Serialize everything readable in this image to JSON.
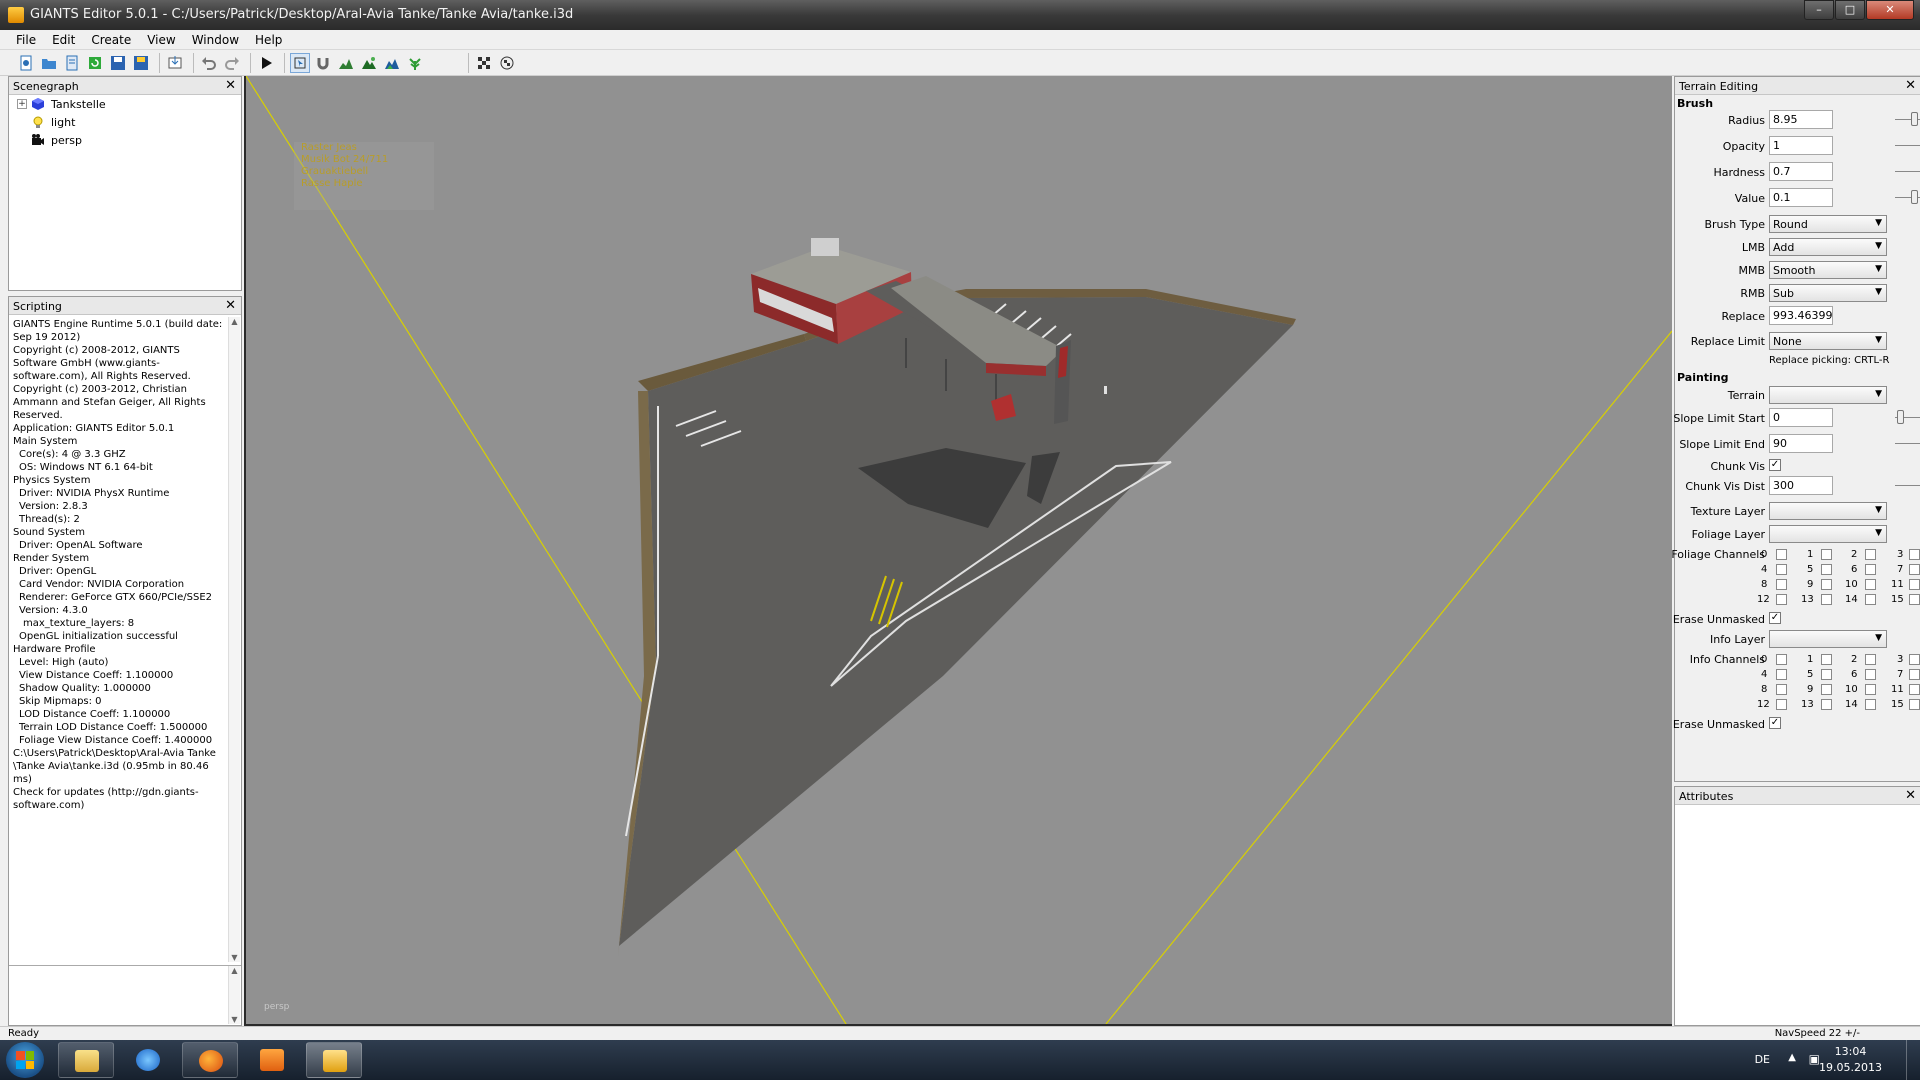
{
  "window": {
    "title": "GIANTS Editor 5.0.1 - C:/Users/Patrick/Desktop/Aral-Avia Tanke/Tanke Avia/tanke.i3d",
    "minimize": "–",
    "maximize": "□",
    "close": "✕"
  },
  "menu": [
    {
      "label": "File"
    },
    {
      "label": "Edit"
    },
    {
      "label": "Create"
    },
    {
      "label": "View"
    },
    {
      "label": "Window"
    },
    {
      "label": "Help"
    }
  ],
  "scenegraph": {
    "title": "Scenegraph",
    "items": [
      {
        "label": "Tankstelle",
        "icon": "cube-icon",
        "expander": "+"
      },
      {
        "label": "light",
        "icon": "light-bulb-icon"
      },
      {
        "label": "persp",
        "icon": "camera-icon"
      }
    ]
  },
  "scripting": {
    "title": "Scripting",
    "log": [
      {
        "text": "GIANTS Engine Runtime 5.0.1 (build date: Sep 19 2012)",
        "indent": 0
      },
      {
        "text": "Copyright (c) 2008-2012, GIANTS Software GmbH (www.giants-software.com), All Rights Reserved.",
        "indent": 0
      },
      {
        "text": "Copyright (c) 2003-2012, Christian Ammann and Stefan Geiger, All Rights Reserved.",
        "indent": 0
      },
      {
        "text": "Application: GIANTS Editor 5.0.1",
        "indent": 0
      },
      {
        "text": "Main System",
        "indent": 0
      },
      {
        "text": "Core(s): 4 @ 3.3 GHZ",
        "indent": 1
      },
      {
        "text": "OS: Windows NT 6.1 64-bit",
        "indent": 1
      },
      {
        "text": "Physics System",
        "indent": 0
      },
      {
        "text": "Driver: NVIDIA PhysX Runtime",
        "indent": 1
      },
      {
        "text": "Version: 2.8.3",
        "indent": 1
      },
      {
        "text": "Thread(s): 2",
        "indent": 1
      },
      {
        "text": "Sound System",
        "indent": 0
      },
      {
        "text": "Driver: OpenAL Software",
        "indent": 1
      },
      {
        "text": "Render System",
        "indent": 0
      },
      {
        "text": "Driver: OpenGL",
        "indent": 1
      },
      {
        "text": "Card Vendor: NVIDIA Corporation",
        "indent": 1
      },
      {
        "text": "Renderer: GeForce GTX 660/PCIe/SSE2",
        "indent": 1
      },
      {
        "text": "Version: 4.3.0",
        "indent": 1
      },
      {
        "text": "max_texture_layers: 8",
        "indent": 2
      },
      {
        "text": "OpenGL initialization successful",
        "indent": 1
      },
      {
        "text": "Hardware Profile",
        "indent": 0
      },
      {
        "text": "Level: High (auto)",
        "indent": 1
      },
      {
        "text": "View Distance Coeff: 1.100000",
        "indent": 1
      },
      {
        "text": "Shadow Quality: 1.000000",
        "indent": 1
      },
      {
        "text": "Skip Mipmaps: 0",
        "indent": 1
      },
      {
        "text": "LOD Distance Coeff: 1.100000",
        "indent": 1
      },
      {
        "text": "Terrain LOD Distance Coeff: 1.500000",
        "indent": 1
      },
      {
        "text": "Foliage View Distance Coeff: 1.400000",
        "indent": 1
      },
      {
        "text": "C:\\Users\\Patrick\\Desktop\\Aral-Avia Tanke \\Tanke Avia\\tanke.i3d (0.95mb in 80.46 ms)",
        "indent": 0
      },
      {
        "text": "Check for updates (http://gdn.giants-software.com)",
        "indent": 0
      }
    ]
  },
  "viewport": {
    "camera_label": "persp",
    "overlay_lines": [
      "Raster Jeas",
      "Musik Bot 24/711",
      "Grauaktiebell",
      "Rasse Haple"
    ]
  },
  "terrain_editing": {
    "title": "Terrain Editing",
    "brush_title": "Brush",
    "radius": {
      "label": "Radius",
      "value": "8.95"
    },
    "opacity": {
      "label": "Opacity",
      "value": "1"
    },
    "hardness": {
      "label": "Hardness",
      "value": "0.7"
    },
    "value": {
      "label": "Value",
      "value": "0.1"
    },
    "brush_type": {
      "label": "Brush Type",
      "value": "Round"
    },
    "lmb": {
      "label": "LMB",
      "value": "Add"
    },
    "mmb": {
      "label": "MMB",
      "value": "Smooth"
    },
    "rmb": {
      "label": "RMB",
      "value": "Sub"
    },
    "replace": {
      "label": "Replace",
      "value": "993.46399"
    },
    "replace_limit": {
      "label": "Replace Limit",
      "value": "None"
    },
    "replace_note": "Replace picking: CRTL-R",
    "painting_title": "Painting",
    "terrain": {
      "label": "Terrain",
      "value": ""
    },
    "slope_start": {
      "label": "Slope Limit Start",
      "value": "0"
    },
    "slope_end": {
      "label": "Slope Limit End",
      "value": "90"
    },
    "chunk_vis": {
      "label": "Chunk Vis",
      "checked": "✓"
    },
    "chunk_vis_dist": {
      "label": "Chunk Vis Dist",
      "value": "300"
    },
    "texture_layer": {
      "label": "Texture Layer",
      "value": ""
    },
    "foliage_layer": {
      "label": "Foliage Layer",
      "value": ""
    },
    "foliage_channels": {
      "label": "Foliage Channels"
    },
    "erase_unmasked_1": {
      "label": "Erase Unmasked",
      "checked": "✓"
    },
    "info_layer": {
      "label": "Info Layer",
      "value": ""
    },
    "info_channels": {
      "label": "Info Channels"
    },
    "erase_unmasked_2": {
      "label": "Erase Unmasked",
      "checked": "✓"
    },
    "channel_numbers": [
      "0",
      "1",
      "2",
      "3",
      "4",
      "5",
      "6",
      "7",
      "8",
      "9",
      "10",
      "11",
      "12",
      "13",
      "14",
      "15"
    ]
  },
  "attributes": {
    "title": "Attributes"
  },
  "status": {
    "left": "Ready",
    "right": "NavSpeed 22 +/-"
  },
  "taskbar": {
    "lang": "DE",
    "time": "13:04",
    "date": "19.05.2013"
  }
}
